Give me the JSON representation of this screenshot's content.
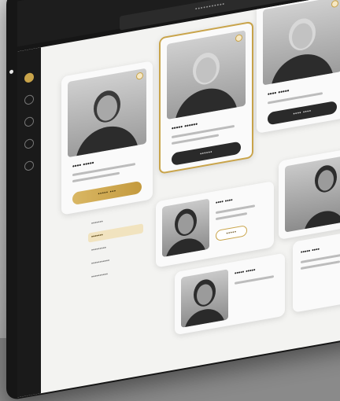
{
  "window": {
    "url": "•••••••••••",
    "top_action_1": "•••••••",
    "top_action_2": "••"
  },
  "rail": {
    "icons": [
      "user-icon",
      "calendar-icon",
      "chat-icon",
      "settings-icon",
      "bell-icon"
    ]
  },
  "cards": [
    {
      "name": "•••• •••••",
      "button": "••••• •••",
      "button_style": "gold"
    },
    {
      "name": "••••• ••••••",
      "button": "••••••",
      "button_style": "dark"
    },
    {
      "name": "•••• •••••",
      "button": "•••• ••••",
      "button_style": "dark"
    }
  ],
  "filters": {
    "heading": "•••••••",
    "items": [
      "•••••••",
      "•••••••••",
      "•••••••••••",
      "••••••••••"
    ]
  },
  "list": [
    {
      "name": "•••• ••••",
      "action": "•••••"
    },
    {
      "name": "••••• •••••",
      "action": ""
    },
    {
      "name": "••••• ••••",
      "action": ""
    }
  ],
  "colors": {
    "accent": "#c9a44a",
    "dark": "#1a1a1a",
    "surface": "#f3f3f1"
  }
}
